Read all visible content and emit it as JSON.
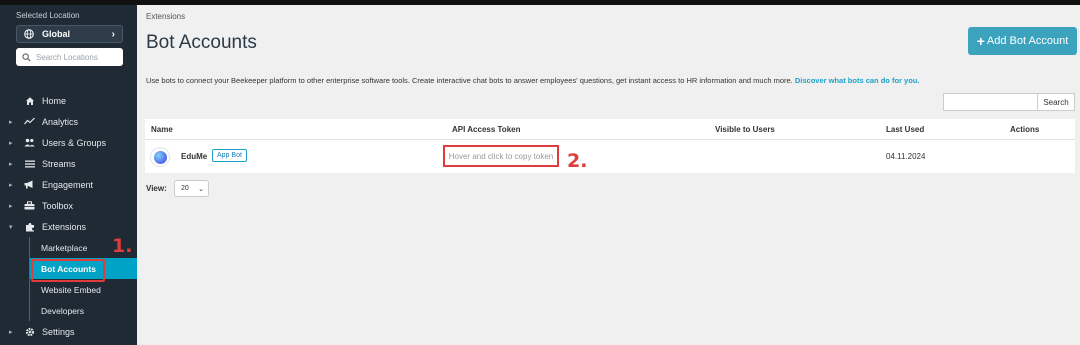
{
  "sidebar": {
    "selected_location_label": "Selected Location",
    "location_value": "Global",
    "search_placeholder": "Search Locations",
    "nav": [
      {
        "label": "Home",
        "icon": "home-icon"
      },
      {
        "label": "Analytics",
        "icon": "analytics-icon"
      },
      {
        "label": "Users & Groups",
        "icon": "users-icon"
      },
      {
        "label": "Streams",
        "icon": "streams-icon"
      },
      {
        "label": "Engagement",
        "icon": "megaphone-icon"
      },
      {
        "label": "Toolbox",
        "icon": "toolbox-icon"
      },
      {
        "label": "Extensions",
        "icon": "puzzle-icon"
      }
    ],
    "extensions_sub": [
      {
        "label": "Marketplace"
      },
      {
        "label": "Bot Accounts"
      },
      {
        "label": "Website Embed"
      },
      {
        "label": "Developers"
      }
    ],
    "settings_label": "Settings"
  },
  "annotations": {
    "step1": "1.",
    "step2": "2."
  },
  "main": {
    "breadcrumb": "Extensions",
    "title": "Bot Accounts",
    "add_button_label": "Add Bot Account",
    "description": "Use bots to connect your Beekeeper platform to other enterprise software tools. Create interactive chat bots to answer employees' questions, get instant access to HR information and much more.",
    "description_link": "Discover what bots can do for you.",
    "search_button": "Search",
    "search_value": "",
    "table": {
      "headers": [
        "Name",
        "API Access Token",
        "Visible to Users",
        "Last Used",
        "Actions"
      ],
      "rows": [
        {
          "name": "EduMe",
          "badge": "App Bot",
          "token": "Hover and click to copy token",
          "visible": "",
          "last_used": "04.11.2024",
          "actions": ""
        }
      ]
    },
    "view_label": "View:",
    "view_value": "20"
  },
  "colors": {
    "accent": "#3ba3bd",
    "active_nav": "#00a2c6",
    "annotation_red": "#e03c3c",
    "sidebar_bg": "#1f2a35"
  }
}
